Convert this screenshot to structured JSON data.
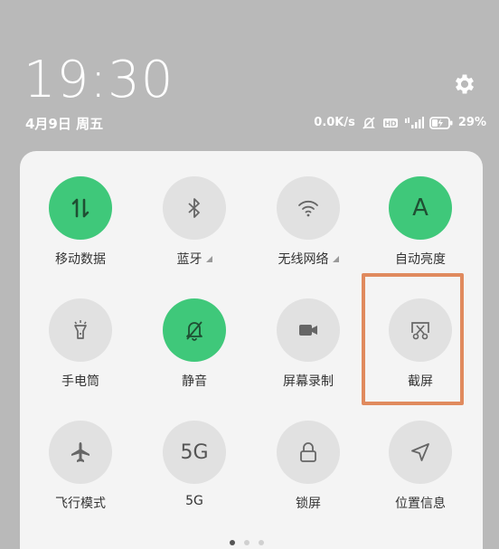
{
  "status": {
    "time": "19:30",
    "date": "4月9日 周五",
    "net_speed": "0.0K/s",
    "battery_pct": "29%"
  },
  "icons": {
    "settings": "gear-icon",
    "mute_status": "bell-off-icon",
    "hd": "hd-icon",
    "signal": "signal-icon",
    "battery": "battery-charging-icon"
  },
  "tiles": [
    {
      "label": "移动数据",
      "icon": "data-transfer-icon",
      "active": true
    },
    {
      "label": "蓝牙",
      "icon": "bluetooth-icon",
      "active": false
    },
    {
      "label": "无线网络",
      "icon": "wifi-icon",
      "active": false
    },
    {
      "label": "自动亮度",
      "icon": "auto-brightness-icon",
      "glyph": "A",
      "active": true
    },
    {
      "label": "手电筒",
      "icon": "flashlight-icon",
      "active": false
    },
    {
      "label": "静音",
      "icon": "bell-off-icon",
      "active": true
    },
    {
      "label": "屏幕录制",
      "icon": "video-camera-icon",
      "active": false
    },
    {
      "label": "截屏",
      "icon": "screenshot-scissors-icon",
      "active": false
    },
    {
      "label": "飞行模式",
      "icon": "airplane-icon",
      "active": false
    },
    {
      "label": "5G",
      "icon": "5g-icon",
      "glyph": "5G",
      "active": false
    },
    {
      "label": "锁屏",
      "icon": "lock-icon",
      "active": false
    },
    {
      "label": "位置信息",
      "icon": "location-arrow-icon",
      "active": false
    }
  ],
  "colors": {
    "active": "#3fc87a",
    "inactive": "#e1e1e1",
    "highlight": "#e08a5e",
    "background": "#b9b9b9"
  },
  "pager": {
    "pages": 3,
    "current": 1
  }
}
